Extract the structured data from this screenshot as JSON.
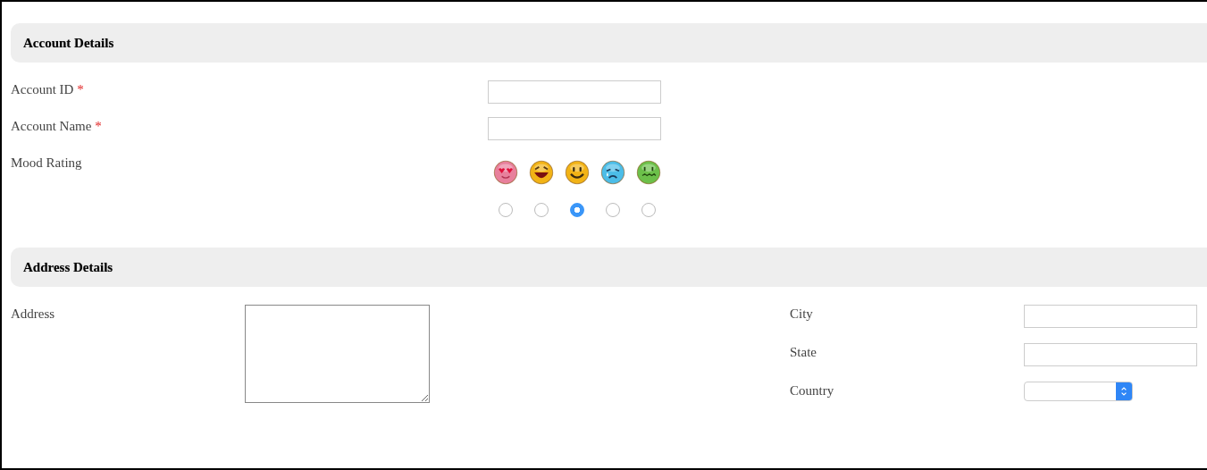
{
  "account_section": {
    "title": "Account Details",
    "fields": [
      {
        "label": "Account ID",
        "required_mark": "*"
      },
      {
        "label": "Account Name",
        "required_mark": "*"
      }
    ],
    "mood": {
      "label": "Mood Rating",
      "options": [
        {
          "kind": "love",
          "color": "#e8809c",
          "selected": false
        },
        {
          "kind": "laughing",
          "color": "#f2b316",
          "selected": false
        },
        {
          "kind": "smile",
          "color": "#f2b316",
          "selected": true
        },
        {
          "kind": "crying",
          "color": "#4cbde8",
          "selected": false
        },
        {
          "kind": "sick",
          "color": "#6cc04a",
          "selected": false
        }
      ]
    }
  },
  "address_section": {
    "title": "Address Details",
    "address": {
      "label": "Address"
    },
    "fields": [
      {
        "label": "City",
        "kind": "text"
      },
      {
        "label": "State",
        "kind": "text"
      },
      {
        "label": "Country",
        "kind": "select"
      }
    ]
  }
}
